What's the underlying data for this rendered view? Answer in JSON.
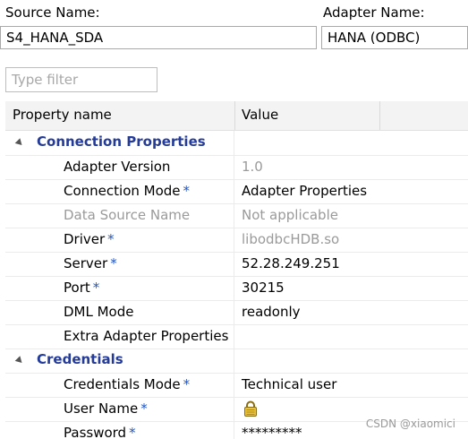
{
  "header": {
    "source_name_label": "Source Name:",
    "source_name_value": "S4_HANA_SDA",
    "adapter_name_label": "Adapter Name:",
    "adapter_name_value": "HANA (ODBC)"
  },
  "filter": {
    "placeholder": "Type filter"
  },
  "table": {
    "columns": [
      "Property name",
      "Value"
    ],
    "categories": [
      {
        "label": "Connection Properties",
        "rows": [
          {
            "name": "Adapter Version",
            "required": "",
            "value": "1.0"
          },
          {
            "name": "Connection Mode",
            "required": "*",
            "value": "Adapter Properties"
          },
          {
            "name": "Data Source Name",
            "required": "",
            "value": "Not applicable"
          },
          {
            "name": "Driver",
            "required": "*",
            "value": "libodbcHDB.so"
          },
          {
            "name": "Server",
            "required": "*",
            "value": "52.28.249.251"
          },
          {
            "name": "Port",
            "required": "*",
            "value": "30215"
          },
          {
            "name": "DML Mode",
            "required": "",
            "value": "readonly"
          },
          {
            "name": "Extra Adapter Properties",
            "required": "",
            "value": ""
          }
        ]
      },
      {
        "label": "Credentials",
        "rows": [
          {
            "name": "Credentials Mode",
            "required": "*",
            "value": "Technical user"
          },
          {
            "name": "User Name",
            "required": "*",
            "value": "",
            "icon": "lock-icon"
          },
          {
            "name": "Password",
            "required": "*",
            "value": "*********"
          }
        ]
      }
    ]
  },
  "watermark": "CSDN @xiaomici",
  "colors": {
    "category_text": "#243b97",
    "required_asterisk": "#1f56c9",
    "disabled_text": "#9a9a9a"
  }
}
